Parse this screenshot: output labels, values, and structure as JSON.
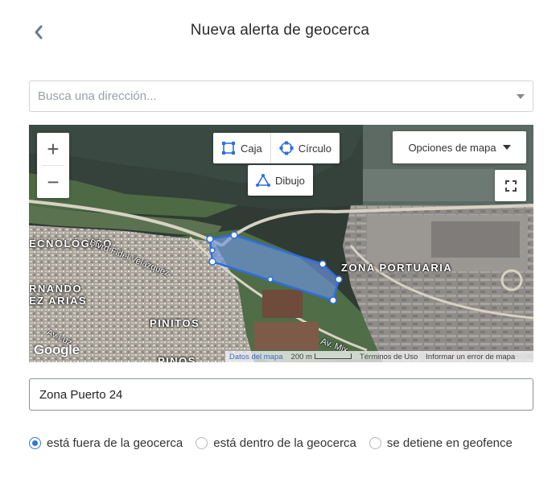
{
  "header": {
    "title": "Nueva alerta de geocerca",
    "back_icon": "chevron-left-icon"
  },
  "search": {
    "placeholder": "Busca una dirección..."
  },
  "map": {
    "draw_tools": {
      "box": "Caja",
      "circle": "Círculo",
      "drawing": "Dibujo"
    },
    "options_label": "Opciones de mapa",
    "zoom_in": "+",
    "zoom_out": "−",
    "labels": {
      "zona_portuaria": "ZONA PORTUARIA",
      "tecnologico": "ECNOLÓGICO",
      "fernando_1": "RNANDO",
      "fernando_2": "EZ ARIAS",
      "pinitos": "PINITOS",
      "pinos": "PINOS"
    },
    "streets": {
      "blvd": "Blvrd Fidel Velázquez",
      "av_mix": "Av. Mix",
      "av_luz": "Av Luz"
    },
    "attribution": {
      "logo": "Google",
      "data": "Datos del mapa",
      "scale": "200 m",
      "terms": "Términos de Uso",
      "report": "Informar un error de mapa"
    },
    "colors": {
      "polygon_stroke": "#2d6fe0",
      "polygon_fill": "#6f95e0"
    }
  },
  "name_field": {
    "value": "Zona Puerto 24"
  },
  "options": [
    {
      "label": "está fuera de la geocerca",
      "selected": true
    },
    {
      "label": "está dentro de la geocerca",
      "selected": false
    },
    {
      "label": "se detiene en geofence",
      "selected": false
    }
  ]
}
